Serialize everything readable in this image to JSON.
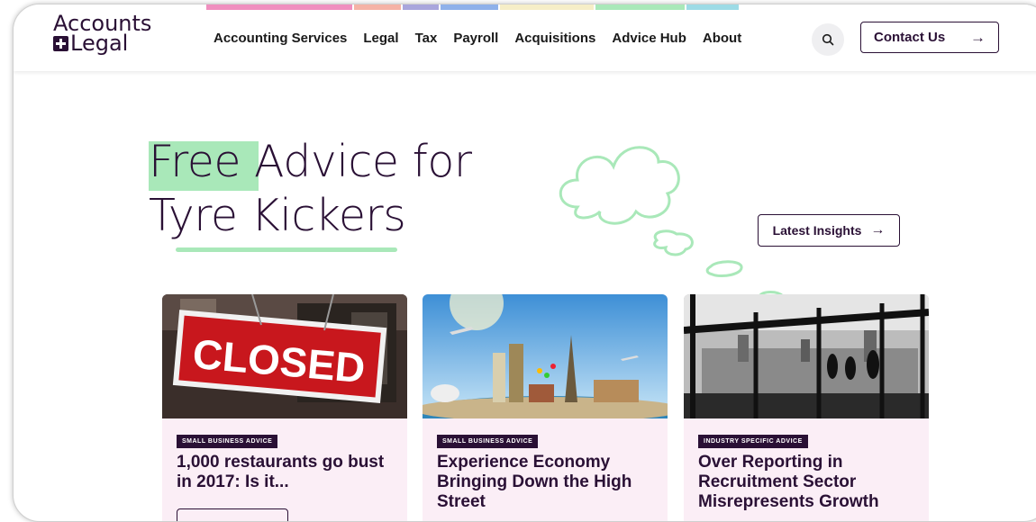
{
  "logo": {
    "line1": "Accounts",
    "line2": "Legal"
  },
  "stripe_colors": [
    "#f08fbf",
    "#f5b3a6",
    "#a9a6dc",
    "#8fb1ea",
    "#f6eec7",
    "#a9e8b9",
    "#9ddbe6"
  ],
  "nav": [
    "Accounting Services",
    "Legal",
    "Tax",
    "Payroll",
    "Acquisitions",
    "Advice Hub",
    "About"
  ],
  "contact_label": "Contact Us",
  "hero": {
    "highlight": "Free",
    "line1_rest": " Advice for",
    "line2": "Tyre Kickers"
  },
  "latest_label": "Latest Insights",
  "cards": [
    {
      "tag": "SMALL BUSINESS ADVICE",
      "title": "1,000 restaurants go bust in 2017: Is it..."
    },
    {
      "tag": "SMALL BUSINESS ADVICE",
      "title": "Experience Economy Bringing Down the High Street"
    },
    {
      "tag": "INDUSTRY SPECIFIC ADVICE",
      "title": "Over Reporting in Recruitment Sector Misrepresents Growth"
    }
  ],
  "card1_sign": "CLOSED"
}
